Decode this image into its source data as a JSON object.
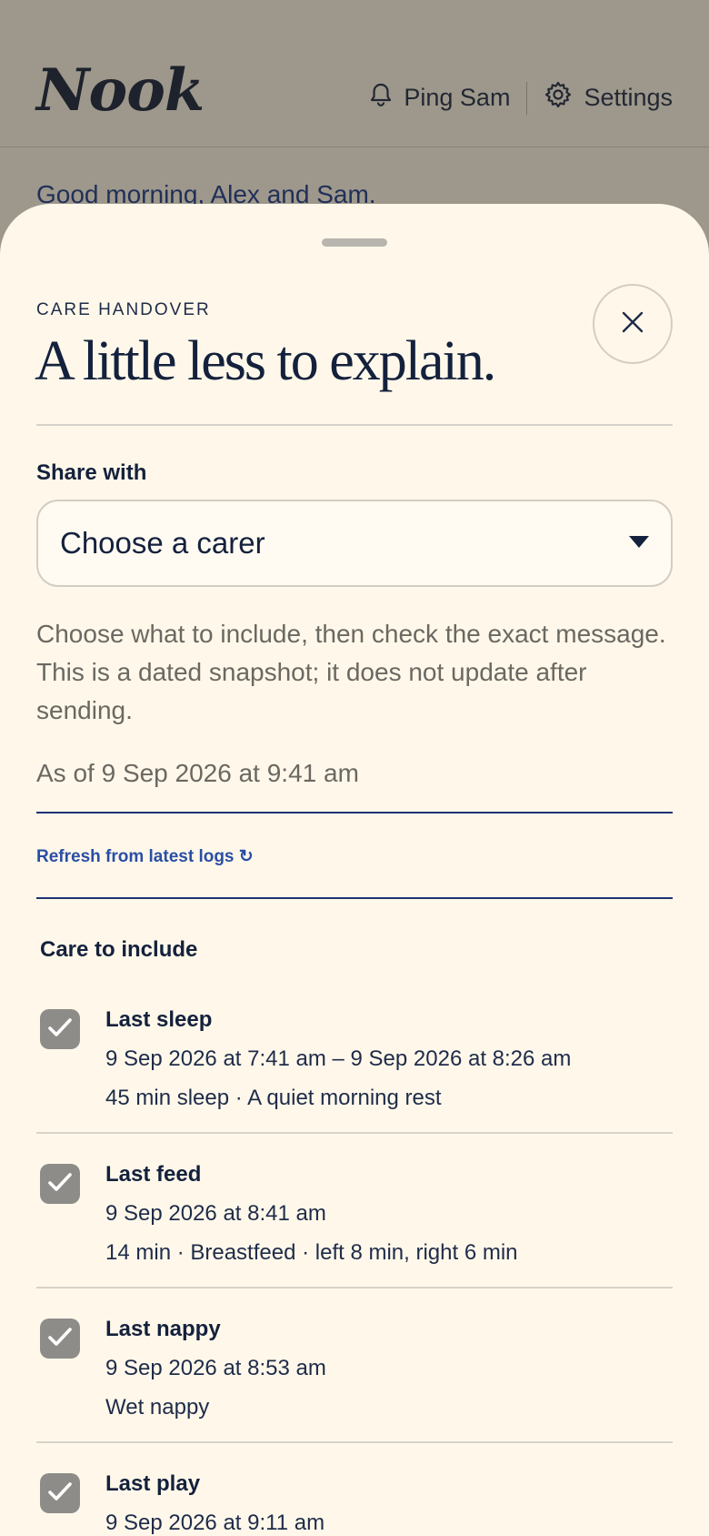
{
  "app": {
    "logo": "Nook",
    "ping_label": "Ping Sam",
    "settings_label": "Settings",
    "greeting": "Good morning, Alex and Sam."
  },
  "sheet": {
    "eyebrow": "CARE HANDOVER",
    "title": "A little less to explain.",
    "share_label": "Share with",
    "carer_select_value": "Choose a carer",
    "help_text": "Choose what to include, then check the exact message. This is a dated snapshot; it does not update after sending.",
    "as_of": "As of 9 Sep 2026 at 9:41 am",
    "refresh_label": "Refresh from latest logs ↻",
    "section_title": "Care to include",
    "items": [
      {
        "title": "Last sleep",
        "line1": "9 Sep 2026 at 7:41 am – 9 Sep 2026 at 8:26 am",
        "line2": "45 min sleep · A quiet morning rest",
        "checked": true
      },
      {
        "title": "Last feed",
        "line1": "9 Sep 2026 at 8:41 am",
        "line2": "14 min · Breastfeed · left 8 min, right 6 min",
        "checked": true
      },
      {
        "title": "Last nappy",
        "line1": "9 Sep 2026 at 8:53 am",
        "line2": "Wet nappy",
        "checked": true
      },
      {
        "title": "Last play",
        "line1": "9 Sep 2026 at 9:11 am",
        "line2": "",
        "checked": true
      }
    ]
  },
  "colors": {
    "ink": "#14213d",
    "link": "#2a4ea6",
    "sheet_bg": "#fff8ea",
    "checkbox": "#8e8c89"
  }
}
